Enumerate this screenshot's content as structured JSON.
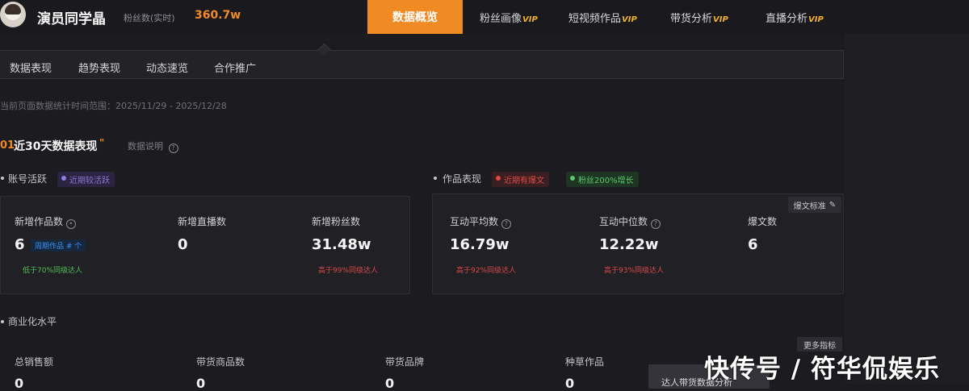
{
  "header": {
    "account_name": "演员同学晶",
    "fans_label": "粉丝数(实时)",
    "fans_value": "360.7w",
    "nav": [
      {
        "label": "数据概览",
        "vip": "",
        "active": true
      },
      {
        "label": "粉丝画像",
        "vip": "VIP",
        "active": false
      },
      {
        "label": "短视频作品",
        "vip": "VIP",
        "active": false
      },
      {
        "label": "带货分析",
        "vip": "VIP",
        "active": false
      },
      {
        "label": "直播分析",
        "vip": "VIP",
        "active": false
      }
    ]
  },
  "subtabs": [
    "数据表现",
    "趋势表现",
    "动态速览",
    "合作推广"
  ],
  "date_range": "当前页面数据统计时间范围：2025/11/29 - 2025/12/28",
  "section": {
    "num": "01",
    "title": "近30天数据表现",
    "quote": "\"",
    "help": "数据说明"
  },
  "account_activity": {
    "label": "账号活跃",
    "badge": "近期较活跃",
    "metrics": [
      {
        "label": "新增作品数",
        "value": "6",
        "tag": "周期作品 # 个",
        "note": "低于70%同级达人"
      },
      {
        "label": "新增直播数",
        "value": "0",
        "tag": "",
        "note": ""
      },
      {
        "label": "新增粉丝数",
        "value": "31.48w",
        "tag": "",
        "note": "高于99%同级达人"
      }
    ]
  },
  "works_performance": {
    "label": "作品表现",
    "badge_red": "近期有爆文",
    "badge_green": "粉丝200%增长",
    "edit_label": "爆文标准",
    "metrics": [
      {
        "label": "互动平均数",
        "value": "16.79w",
        "note": "高于92%同级达人"
      },
      {
        "label": "互动中位数",
        "value": "12.22w",
        "note": "高于93%同级达人"
      },
      {
        "label": "爆文数",
        "value": "6",
        "note": ""
      }
    ]
  },
  "commerce": {
    "label": "商业化水平",
    "more_label": "更多指标",
    "columns": [
      "总销售额",
      "带货商品数",
      "带货品牌",
      "种草作品"
    ],
    "values": [
      "0",
      "0",
      "0",
      "0"
    ],
    "cta_label": "达人带货数据分析"
  },
  "watermark": "快传号 / 符华侃娱乐"
}
